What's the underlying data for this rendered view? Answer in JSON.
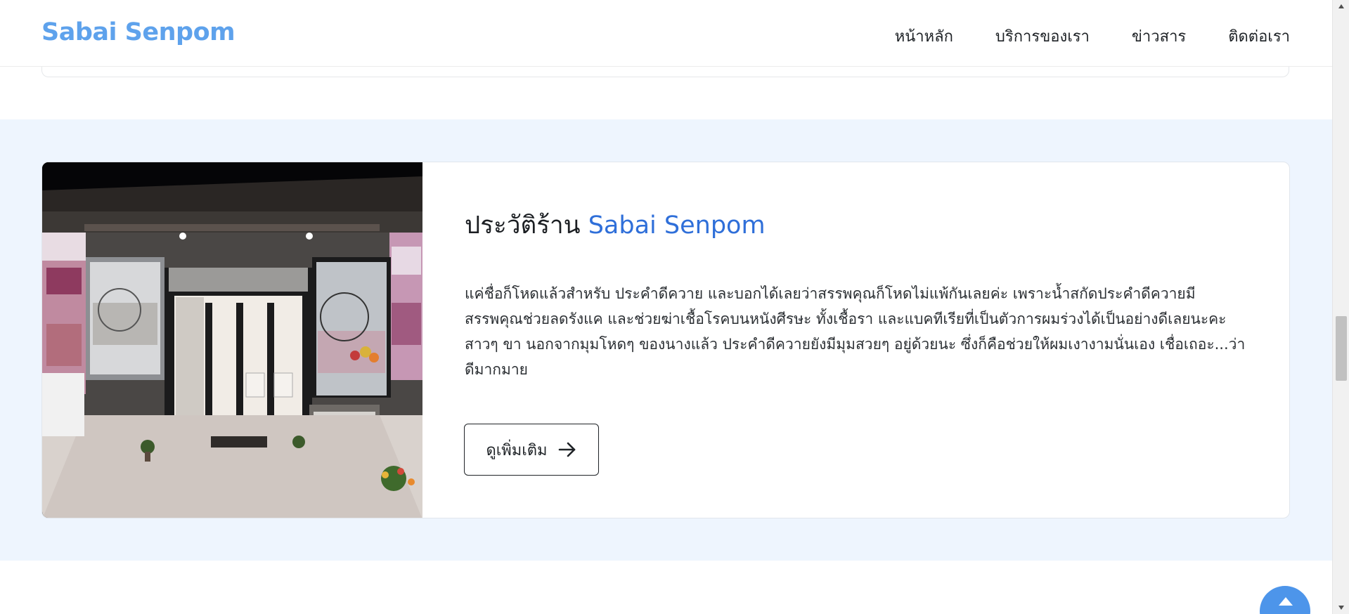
{
  "brand": {
    "name": "Sabai Senpom",
    "color": "#5ea2ec"
  },
  "nav": {
    "items": [
      {
        "label": "หน้าหลัก"
      },
      {
        "label": "บริการของเรา"
      },
      {
        "label": "ข่าวสาร"
      },
      {
        "label": "ติดต่อเรา"
      }
    ]
  },
  "about": {
    "title_prefix": "ประวัติร้าน",
    "title_accent": "Sabai Senpom",
    "accent_color": "#2f6fd9",
    "body": "แค่ชื่อก็โหดแล้วสำหรับ ประคำดีควาย และบอกได้เลยว่าสรรพคุณก็โหดไม่แพ้กันเลยค่ะ เพราะน้ำสกัดประคำดีควายมีสรรพคุณช่วยลดรังแค และช่วยฆ่าเชื้อโรคบนหนังศีรษะ ทั้งเชื้อรา และแบคทีเรียที่เป็นตัวการผมร่วงได้เป็นอย่างดีเลยนะคะสาวๆ ขา นอกจากมุมโหดๆ ของนางแล้ว ประคำดีควายยังมีมุมสวยๆ อยู่ด้วยนะ ซึ่งก็คือช่วยให้ผมเงางามนั่นเอง เชื่อเถอะ...ว่าดีมากมาย",
    "button_label": "ดูเพิ่มเติม",
    "button_icon": "arrow-right-icon",
    "section_bg": "#eef5fe"
  },
  "back_to_top": {
    "icon": "chevron-up-icon",
    "color": "#4d95ea"
  },
  "colors": {
    "text": "#212529",
    "border": "#e1e6ec"
  }
}
